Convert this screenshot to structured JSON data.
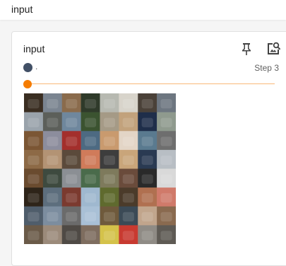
{
  "topbar": {
    "title": "input"
  },
  "card": {
    "title": "input",
    "run_name": ".",
    "step_label": "Step 3"
  },
  "slider": {
    "value": 0
  },
  "colors": {
    "run": "#425066",
    "accent": "#f57c00",
    "track": "#f9b978"
  },
  "icons": {
    "pin": "pin-icon",
    "image_search": "image-search-icon"
  },
  "image": {
    "rows": 8,
    "cols": 8,
    "tiles": [
      "#3a2e22",
      "#7a8490",
      "#8a6b4c",
      "#2f3a2a",
      "#b7b9b1",
      "#d8d4cb",
      "#4a4138",
      "#6d7680",
      "#9aa3ab",
      "#5c5f5a",
      "#6f879d",
      "#3b5330",
      "#a59a86",
      "#c2a27c",
      "#1f2e4a",
      "#8f9a8e",
      "#7b5634",
      "#8c8d9d",
      "#a32f2c",
      "#4d6a82",
      "#c99a6e",
      "#e3d5c6",
      "#5a7a8f",
      "#6e6e6e",
      "#8d6a46",
      "#b39374",
      "#5b4a3b",
      "#d07b5a",
      "#3d3d3d",
      "#c9a57a",
      "#2a3a52",
      "#b8bec4",
      "#6a4b2f",
      "#3e4a3f",
      "#8b8f94",
      "#4a6b4b",
      "#7e7a5c",
      "#6a4b3b",
      "#2a2a2a",
      "#d9d9d9",
      "#2e2419",
      "#5d6e7d",
      "#7b3a2f",
      "#9fb8cf",
      "#5f6a2e",
      "#4b3b2a",
      "#b07050",
      "#d07a6a",
      "#4f5d6b",
      "#7c8d9f",
      "#6b6b6b",
      "#a9c0d6",
      "#6f5a3c",
      "#3b4a56",
      "#c1a58c",
      "#8a6a4f",
      "#6a5a48",
      "#9b8a7a",
      "#4f4a45",
      "#7e6d5f",
      "#d4c24a",
      "#c83a30",
      "#8f8b85",
      "#5e5a54"
    ]
  }
}
